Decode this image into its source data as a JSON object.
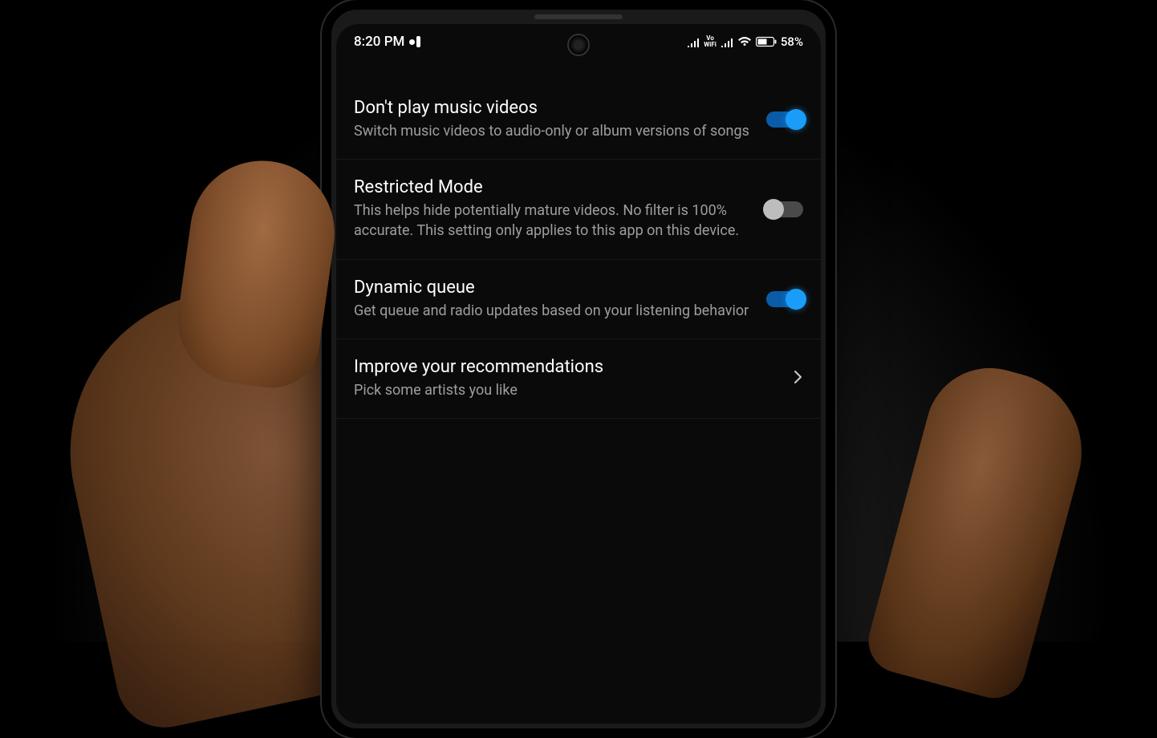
{
  "status_bar": {
    "time": "8:20 PM",
    "battery_text": "58%"
  },
  "settings": [
    {
      "title": "Don't play music videos",
      "desc": "Switch music videos to audio-only or album versions of songs",
      "toggle": true
    },
    {
      "title": "Restricted Mode",
      "desc": "This helps hide potentially mature videos. No filter is 100% accurate. This setting only applies to this app on this device.",
      "toggle": false
    },
    {
      "title": "Dynamic queue",
      "desc": "Get queue and radio updates based on your listening behavior",
      "toggle": true
    },
    {
      "title": "Improve your recommendations",
      "desc": "Pick some artists you like",
      "nav": true
    }
  ]
}
